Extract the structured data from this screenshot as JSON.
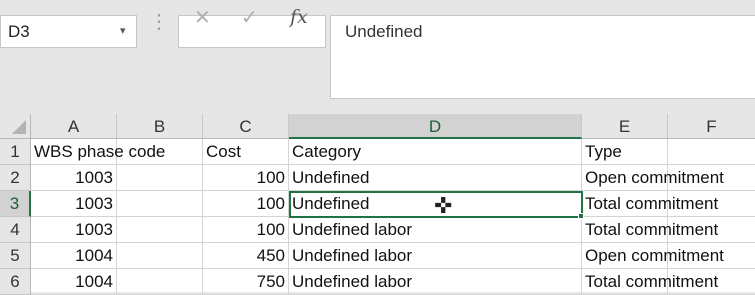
{
  "namebox": {
    "value": "D3",
    "arrow": "▾"
  },
  "formula_bar": {
    "cancel": "✕",
    "enter": "✓",
    "fx": "fx",
    "value": "Undefined"
  },
  "columns": [
    "A",
    "B",
    "C",
    "D",
    "E",
    "F"
  ],
  "rows": [
    "1",
    "2",
    "3",
    "4",
    "5",
    "6"
  ],
  "cells": [
    [
      "WBS phase code",
      "",
      "Cost",
      "Category",
      "Type",
      ""
    ],
    [
      "1003",
      "",
      "100",
      "Undefined",
      "Open commitment",
      ""
    ],
    [
      "1003",
      "",
      "100",
      "Undefined",
      "Total commitment",
      ""
    ],
    [
      "1003",
      "",
      "100",
      "Undefined labor",
      "Total commitment",
      ""
    ],
    [
      "1004",
      "",
      "450",
      "Undefined labor",
      "Open commitment",
      ""
    ],
    [
      "1004",
      "",
      "750",
      "Undefined labor",
      "Total commitment",
      ""
    ]
  ],
  "active_cell": "D3",
  "colors": {
    "selection": "#217346",
    "header_bg": "#e6e6e6",
    "selected_header_bg": "#d2d2d2"
  }
}
